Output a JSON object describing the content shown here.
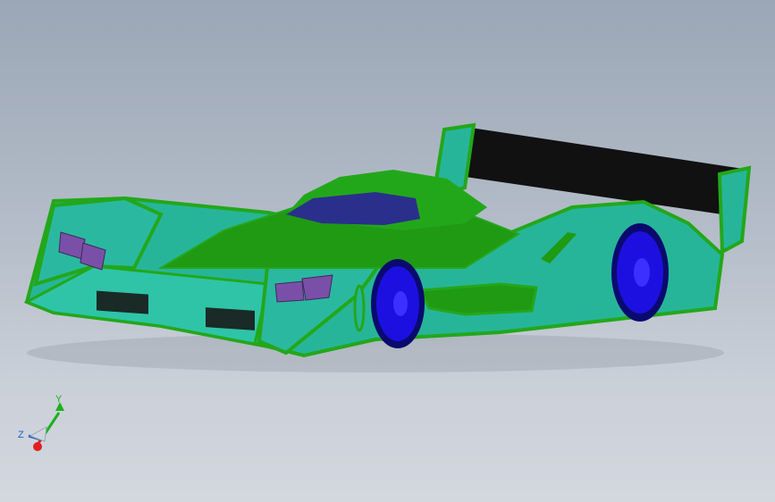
{
  "viewport": {
    "background_top": "#9ba7b6",
    "background_bottom": "#d3d8df"
  },
  "model": {
    "body_color": "#27b59a",
    "fillet_color": "#23a71a",
    "wheel_color": "#1c10e0",
    "wing_color": "#111111",
    "light_color": "#7a4fa8",
    "canopy_color": "#2a2f8c"
  },
  "triad": {
    "y_label": "Y",
    "z_label": "Z",
    "y_color": "#1db01d",
    "z_color": "#2060d0",
    "x_color": "#e02020"
  }
}
